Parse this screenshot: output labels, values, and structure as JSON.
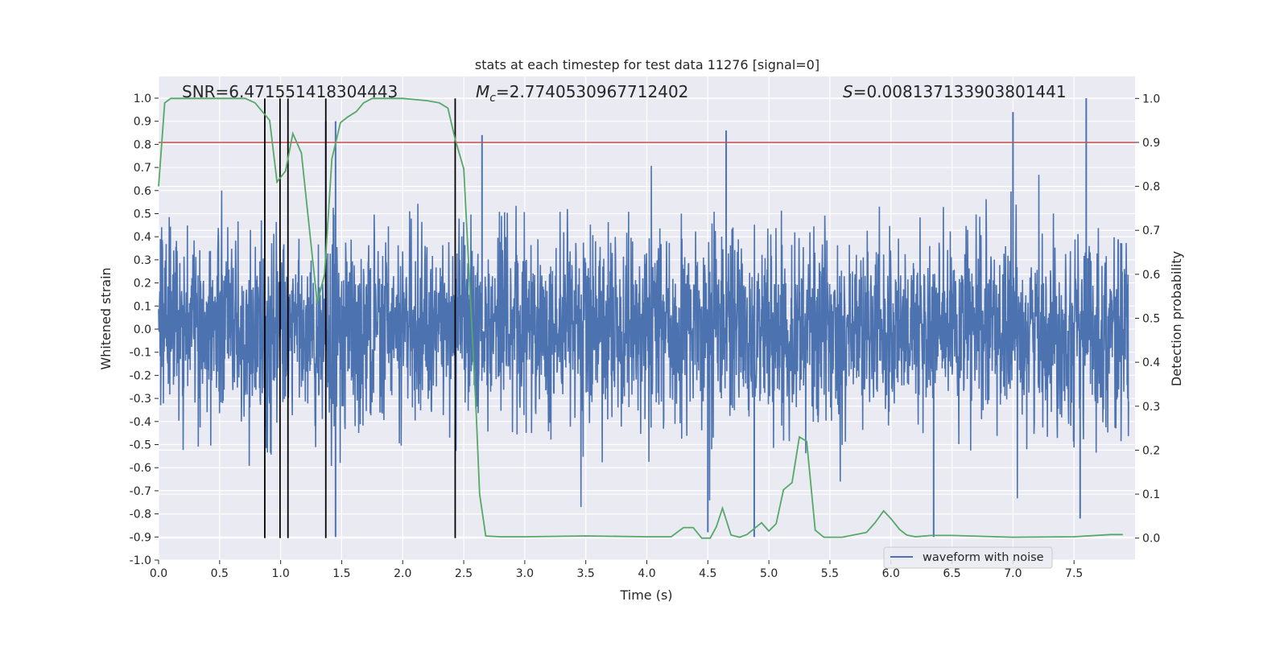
{
  "chart_data": {
    "type": "line",
    "title": "stats at each timestep for test data 11276 [signal=0]",
    "xlabel": "Time (s)",
    "ylabel": "Whitened strain",
    "ylabel_right": "Detection probability",
    "xlim": [
      0,
      8
    ],
    "ylim": [
      -1.0,
      1.094
    ],
    "ylim_right": [
      -0.05,
      1.05
    ],
    "x_ticks": [
      "0.0",
      "0.5",
      "1.0",
      "1.5",
      "2.0",
      "2.5",
      "3.0",
      "3.5",
      "4.0",
      "4.5",
      "5.0",
      "5.5",
      "6.0",
      "6.5",
      "7.0",
      "7.5"
    ],
    "y_ticks": [
      "-1.0",
      "-0.9",
      "-0.8",
      "-0.7",
      "-0.6",
      "-0.5",
      "-0.4",
      "-0.3",
      "-0.2",
      "-0.1",
      "0.0",
      "0.1",
      "0.2",
      "0.3",
      "0.4",
      "0.5",
      "0.6",
      "0.7",
      "0.8",
      "0.9",
      "1.0"
    ],
    "y_ticks_right": [
      "0.0",
      "0.1",
      "0.2",
      "0.3",
      "0.4",
      "0.5",
      "0.6",
      "0.7",
      "0.8",
      "0.9",
      "1.0"
    ],
    "grid": true,
    "legend": {
      "placement": "lower-right",
      "entries": [
        "waveform with noise"
      ]
    },
    "annotations": {
      "snr": "SNR=6.471551418304443",
      "mc_symbol": "M",
      "mc_sub": "c",
      "mc_value": "=2.7740530967712402",
      "s_symbol": "S",
      "s_value": "=0.008137133903801441"
    },
    "colors": {
      "waveform": "#4C72B0",
      "probability": "#55A868",
      "threshold": "#C44E52",
      "markers": "#000000",
      "background": "#EAEAF2"
    },
    "series": [
      {
        "name": "waveform with noise",
        "axis": "left",
        "style": "dense noise, roughly ±0.3 solid band with spikes up to ±0.9",
        "notable_peaks": [
          [
            1.37,
            0.9
          ],
          [
            1.45,
            0.9
          ],
          [
            2.65,
            0.84
          ],
          [
            4.65,
            0.86
          ],
          [
            7.0,
            0.94
          ],
          [
            7.6,
            1.0
          ],
          [
            1.45,
            -0.9
          ],
          [
            4.5,
            -0.88
          ],
          [
            4.88,
            -0.9
          ],
          [
            6.35,
            -0.9
          ],
          [
            7.55,
            -0.82
          ]
        ]
      },
      {
        "axis": "right",
        "x": [
          0,
          0.05,
          0.1,
          0.2,
          0.3,
          0.4,
          0.5,
          0.6,
          0.66,
          0.71,
          0.79,
          0.85,
          0.91,
          0.97,
          1.04,
          1.1,
          1.17,
          1.3,
          1.36,
          1.42,
          1.49,
          1.55,
          1.62,
          1.68,
          1.75,
          1.85,
          2.0,
          2.2,
          2.3,
          2.37,
          2.43,
          2.5,
          2.6,
          2.63,
          2.68,
          2.8,
          3.0,
          3.5,
          4.0,
          4.2,
          4.3,
          4.38,
          4.45,
          4.52,
          4.57,
          4.62,
          4.69,
          4.76,
          4.82,
          4.94,
          5.0,
          5.06,
          5.12,
          5.19,
          5.25,
          5.31,
          5.38,
          5.45,
          5.6,
          5.8,
          5.87,
          5.94,
          6.0,
          6.07,
          6.13,
          6.2,
          6.33,
          6.5,
          7.0,
          7.5,
          7.8,
          7.9
        ],
        "values": [
          0.8,
          0.99,
          1.0,
          1.0,
          1.0,
          1.0,
          1.0,
          1.0,
          1.0,
          1.0,
          0.99,
          0.97,
          0.95,
          0.81,
          0.835,
          0.92,
          0.876,
          0.534,
          0.6,
          0.863,
          0.945,
          0.958,
          0.97,
          0.99,
          1.0,
          1.0,
          1.0,
          0.995,
          0.99,
          0.978,
          0.907,
          0.84,
          0.3,
          0.1,
          0.005,
          0.003,
          0.003,
          0.005,
          0.003,
          0.003,
          0.024,
          0.024,
          0.0,
          0.0,
          0.026,
          0.068,
          0.007,
          0.002,
          0.008,
          0.035,
          0.016,
          0.033,
          0.11,
          0.126,
          0.23,
          0.22,
          0.018,
          0.002,
          0.002,
          0.013,
          0.035,
          0.062,
          0.044,
          0.02,
          0.007,
          0.003,
          0.006,
          0.006,
          0.002,
          0.003,
          0.008,
          0.008
        ]
      }
    ],
    "threshold_right": 0.9,
    "marker_lines_x": [
      0.87,
      0.995,
      1.06,
      1.37,
      2.43
    ]
  }
}
